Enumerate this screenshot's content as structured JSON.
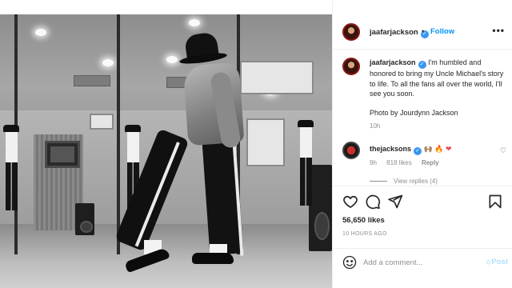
{
  "header": {
    "username": "jaafarjackson",
    "verified_mark": "✓",
    "follow_label": "Follow",
    "separator": "•",
    "more_label": "•••"
  },
  "caption": {
    "username": "jaafarjackson",
    "text": "I'm humbled and honored to bring my Uncle Michael's story to life. To all the fans all over the world, I'll see you soon.",
    "credit": "Photo by Jourdynn Jackson",
    "time": "10h"
  },
  "comment": {
    "username": "thejacksons",
    "emoji_text": "🙌🏽 🔥",
    "heart": "❤",
    "time": "9h",
    "likes": "818 likes",
    "reply_label": "Reply",
    "like_icon": "♡",
    "view_replies": "View replies (4)"
  },
  "actions": {
    "likes": "56,650 likes",
    "time_ago": "10 HOURS AGO"
  },
  "add_comment": {
    "placeholder": "Add a comment...",
    "post_label": "Post"
  },
  "icons": [
    "heart-icon",
    "comment-icon",
    "share-icon",
    "bookmark-icon",
    "emoji-icon",
    "verified-icon"
  ],
  "colors": {
    "accent": "#0095f6",
    "verified": "#3897f0",
    "muted": "#8e8e8e",
    "post_disabled": "#b2dffc",
    "red": "#ed4956"
  }
}
